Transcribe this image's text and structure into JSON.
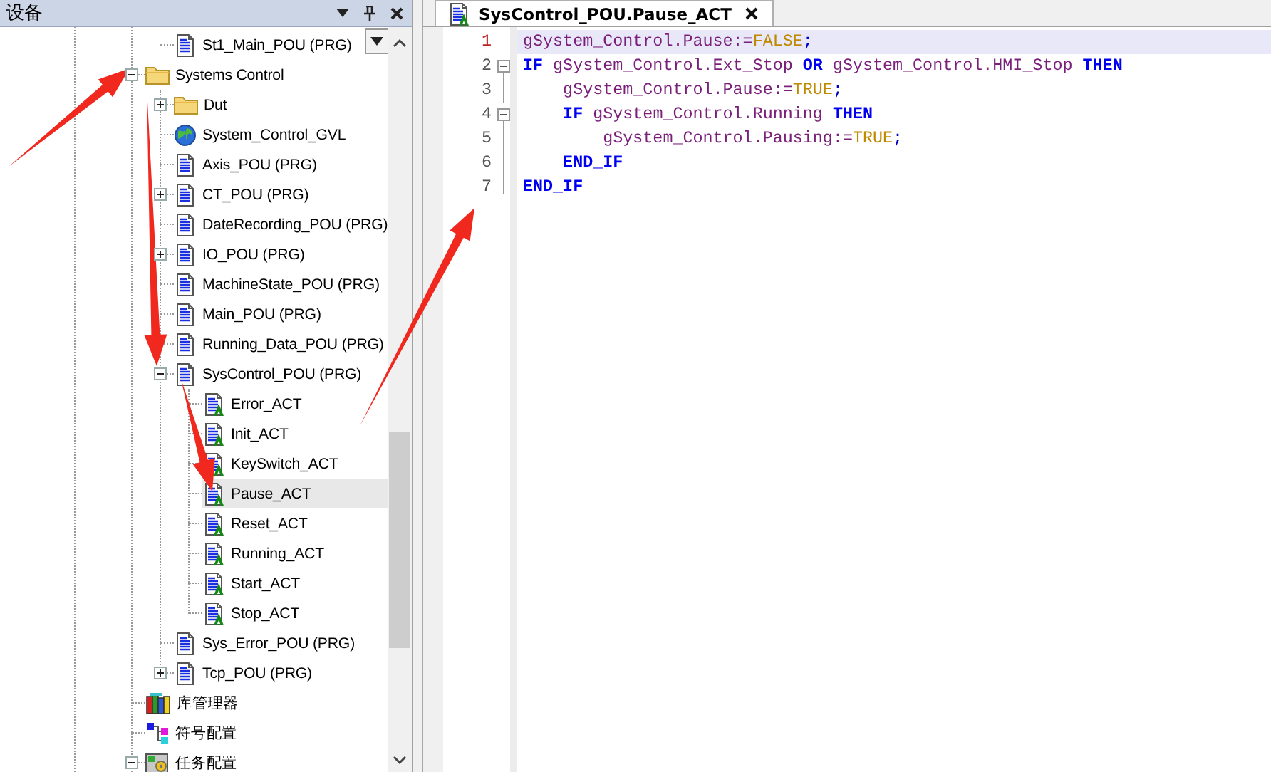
{
  "device_panel": {
    "title": "设备",
    "scrolled_children": [
      {
        "label": "St1_Main_POU (PRG)",
        "kind": "program",
        "selected": false
      }
    ],
    "tree": [
      {
        "label": "Systems Control",
        "kind": "folder",
        "expanded": true,
        "selected": false,
        "children": [
          {
            "label": "Dut",
            "kind": "folder",
            "expanded": false,
            "selected": false
          },
          {
            "label": "System_Control_GVL",
            "kind": "gvl",
            "selected": false
          },
          {
            "label": "Axis_POU (PRG)",
            "kind": "program",
            "selected": false
          },
          {
            "label": "CT_POU (PRG)",
            "kind": "program",
            "expanded": false,
            "selected": false
          },
          {
            "label": "DateRecording_POU (PRG)",
            "kind": "program",
            "selected": false
          },
          {
            "label": "IO_POU (PRG)",
            "kind": "program",
            "expanded": false,
            "selected": false
          },
          {
            "label": "MachineState_POU (PRG)",
            "kind": "program",
            "selected": false
          },
          {
            "label": "Main_POU (PRG)",
            "kind": "program",
            "selected": false
          },
          {
            "label": "Running_Data_POU (PRG)",
            "kind": "program",
            "selected": false
          },
          {
            "label": "SysControl_POU (PRG)",
            "kind": "program",
            "expanded": true,
            "selected": false,
            "children": [
              {
                "label": "Error_ACT",
                "kind": "action",
                "selected": false
              },
              {
                "label": "Init_ACT",
                "kind": "action",
                "selected": false
              },
              {
                "label": "KeySwitch_ACT",
                "kind": "action",
                "selected": false
              },
              {
                "label": "Pause_ACT",
                "kind": "action",
                "selected": true
              },
              {
                "label": "Reset_ACT",
                "kind": "action",
                "selected": false
              },
              {
                "label": "Running_ACT",
                "kind": "action",
                "selected": false
              },
              {
                "label": "Start_ACT",
                "kind": "action",
                "selected": false
              },
              {
                "label": "Stop_ACT",
                "kind": "action",
                "selected": false
              }
            ]
          },
          {
            "label": "Sys_Error_POU (PRG)",
            "kind": "program",
            "selected": false
          },
          {
            "label": "Tcp_POU (PRG)",
            "kind": "program",
            "expanded": false,
            "selected": false
          }
        ]
      },
      {
        "label": "库管理器",
        "kind": "library",
        "selected": false
      },
      {
        "label": "符号配置",
        "kind": "symbol",
        "selected": false
      },
      {
        "label": "任务配置",
        "kind": "task",
        "expanded": true,
        "selected": false
      }
    ]
  },
  "editor": {
    "tabs": [
      {
        "label": "SysControl_POU.Pause_ACT",
        "kind": "action",
        "selected": true
      }
    ],
    "lines": [
      {
        "number": "1",
        "current": true,
        "kind": "plain",
        "tokens": [
          {
            "kind": "variable",
            "text": "gSystem_Control.Pause"
          },
          {
            "kind": "operator",
            "text": ":="
          },
          {
            "kind": "literal",
            "text": "FALSE"
          },
          {
            "kind": "punct",
            "text": ";"
          }
        ]
      },
      {
        "number": "2",
        "current": false,
        "kind": "fold-start",
        "tokens": [
          {
            "kind": "keyword",
            "text": "IF"
          },
          {
            "kind": "variable",
            "text": " gSystem_Control.Ext_Stop "
          },
          {
            "kind": "keyword",
            "text": "OR"
          },
          {
            "kind": "variable",
            "text": " gSystem_Control.HMI_Stop "
          },
          {
            "kind": "keyword",
            "text": "THEN"
          }
        ]
      },
      {
        "number": "3",
        "current": false,
        "kind": "fold-inside",
        "tokens": [
          {
            "kind": "variable",
            "text": "    gSystem_Control.Pause"
          },
          {
            "kind": "operator",
            "text": ":="
          },
          {
            "kind": "literal",
            "text": "TRUE"
          },
          {
            "kind": "punct",
            "text": ";"
          }
        ]
      },
      {
        "number": "4",
        "current": false,
        "kind": "fold-start",
        "tokens": [
          {
            "kind": "keyword",
            "text": "    IF"
          },
          {
            "kind": "variable",
            "text": " gSystem_Control.Running "
          },
          {
            "kind": "keyword",
            "text": "THEN"
          }
        ]
      },
      {
        "number": "5",
        "current": false,
        "kind": "fold-inside",
        "tokens": [
          {
            "kind": "variable",
            "text": "        gSystem_Control.Pausing"
          },
          {
            "kind": "operator",
            "text": ":="
          },
          {
            "kind": "literal",
            "text": "TRUE"
          },
          {
            "kind": "punct",
            "text": ";"
          }
        ]
      },
      {
        "number": "6",
        "current": false,
        "kind": "fold-inside",
        "tokens": [
          {
            "kind": "keyword",
            "text": "    END_IF"
          }
        ]
      },
      {
        "number": "7",
        "current": false,
        "kind": "fold-end",
        "tokens": [
          {
            "kind": "keyword",
            "text": "END_IF"
          }
        ]
      }
    ]
  }
}
